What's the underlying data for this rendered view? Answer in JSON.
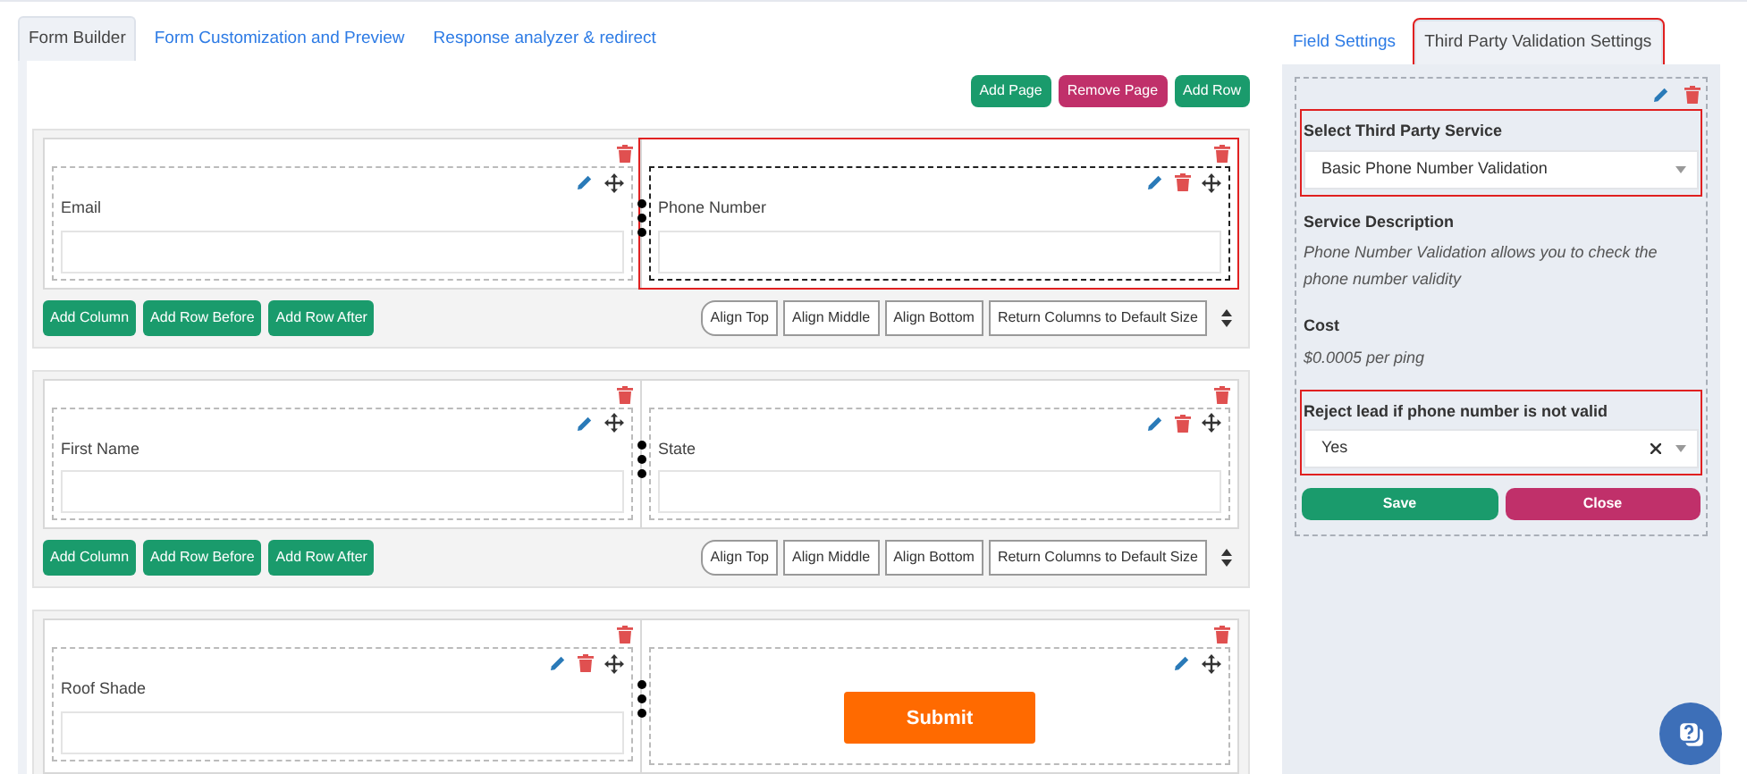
{
  "builder_tabs": [
    {
      "label": "Form Builder",
      "selected": true
    },
    {
      "label": "Form Customization and Preview",
      "selected": false
    },
    {
      "label": "Response analyzer & redirect",
      "selected": false
    }
  ],
  "page_buttons": [
    {
      "label": "Add Page",
      "kind": "add"
    },
    {
      "label": "Remove Page",
      "kind": "remove"
    },
    {
      "label": "Add Row",
      "kind": "add"
    }
  ],
  "rows": [
    {
      "columns": [
        {
          "label": "Email",
          "kind": "input",
          "deletable": false,
          "selected": false,
          "highlighted": false
        },
        {
          "label": "Phone Number",
          "kind": "input",
          "deletable": true,
          "selected": true,
          "highlighted": true
        }
      ],
      "row_buttons": [
        "Add Column",
        "Add Row Before",
        "Add Row After"
      ],
      "align_buttons": [
        "Align Top",
        "Align Middle",
        "Align Bottom",
        "Return Columns to Default Size"
      ]
    },
    {
      "columns": [
        {
          "label": "First Name",
          "kind": "input",
          "deletable": false,
          "selected": false,
          "highlighted": false
        },
        {
          "label": "State",
          "kind": "input",
          "deletable": true,
          "selected": false,
          "highlighted": false
        }
      ],
      "row_buttons": [
        "Add Column",
        "Add Row Before",
        "Add Row After"
      ],
      "align_buttons": [
        "Align Top",
        "Align Middle",
        "Align Bottom",
        "Return Columns to Default Size"
      ]
    },
    {
      "columns": [
        {
          "label": "Roof Shade",
          "kind": "input",
          "deletable": true,
          "selected": false,
          "highlighted": false
        },
        {
          "label": "Submit",
          "kind": "submit",
          "deletable": false,
          "selected": false,
          "highlighted": false
        }
      ]
    }
  ],
  "settings_tabs": [
    {
      "label": "Field Settings",
      "selected": false,
      "highlighted": false
    },
    {
      "label": "Third Party Validation Settings",
      "selected": true,
      "highlighted": true
    }
  ],
  "settings": {
    "service_label": "Select Third Party Service",
    "service_value": "Basic Phone Number Validation",
    "service_highlighted": true,
    "description_heading": "Service Description",
    "description": "Phone Number Validation allows you to check the phone number validity",
    "cost_heading": "Cost",
    "cost": "$0.0005 per ping",
    "reject_label": "Reject lead if phone number is not valid",
    "reject_value": "Yes",
    "reject_highlighted": true,
    "buttons": [
      {
        "label": "Save",
        "kind": "save"
      },
      {
        "label": "Close",
        "kind": "close"
      }
    ]
  }
}
